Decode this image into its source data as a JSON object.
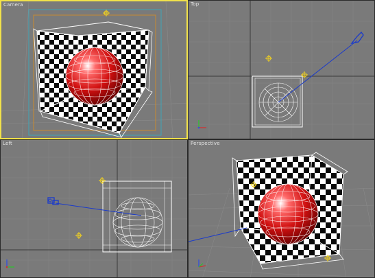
{
  "viewports": [
    {
      "label": "Camera",
      "active": true
    },
    {
      "label": "Top",
      "active": false
    },
    {
      "label": "Left",
      "active": false
    },
    {
      "label": "Perspective",
      "active": false
    }
  ],
  "icons": {
    "axis": "axis-tripod-icon",
    "camera": "camera-icon",
    "light": "omni-light-icon",
    "target": "camera-target-icon"
  },
  "colors": {
    "viewport_bg": "#7a7a7a",
    "grid_line": "#868686",
    "grid_axis": "#3a3a3a",
    "active_border": "#f2e24a",
    "wireframe": "#ffffff",
    "camera_blue": "#1a3acb",
    "light_yellow": "#f0d020",
    "sphere_red": "#cc1010",
    "safe_frame_cyan": "#3fa6b8",
    "safe_frame_orange": "#c88a30",
    "axis_x": "#d03030",
    "axis_y": "#30c030",
    "axis_z": "#3050e0"
  }
}
